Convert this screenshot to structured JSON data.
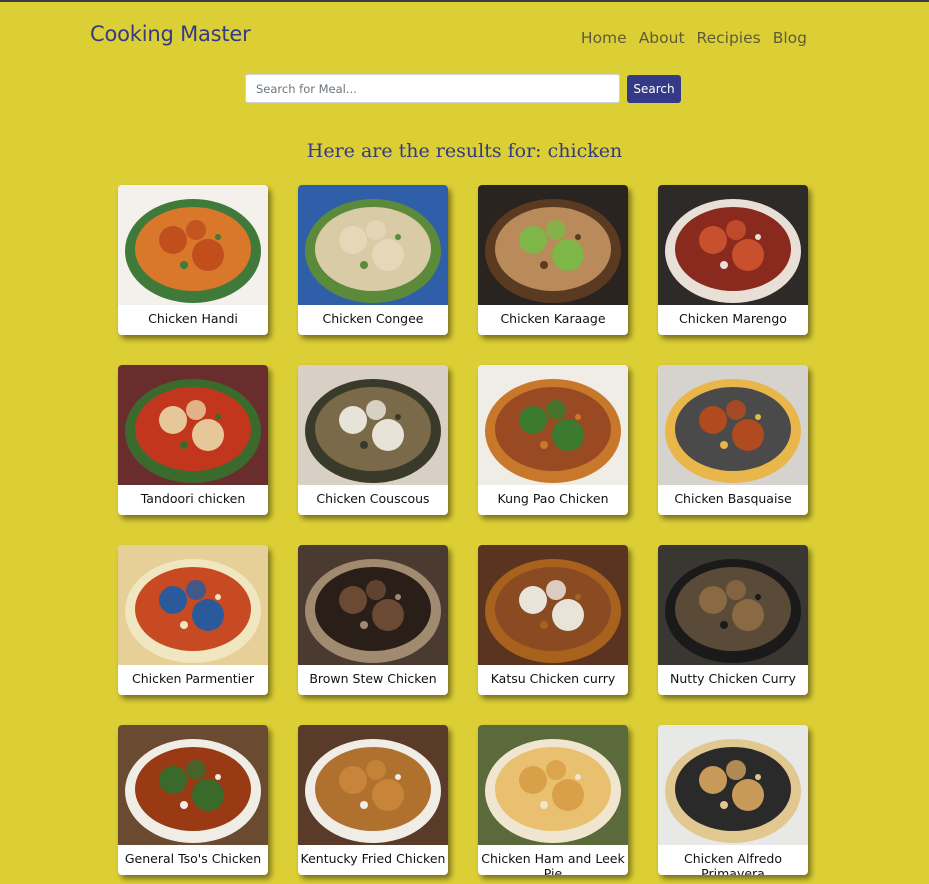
{
  "header": {
    "brand": "Cooking Master",
    "nav": [
      "Home",
      "About",
      "Recipies",
      "Blog"
    ]
  },
  "search": {
    "placeholder": "Search for Meal...",
    "value": "",
    "button_label": "Search"
  },
  "results": {
    "title": "Here are the results for: chicken",
    "meals": [
      {
        "name": "Chicken Handi",
        "colors": [
          "#f4f0ec",
          "#d9772a",
          "#c14f1d",
          "#3f7a3a"
        ]
      },
      {
        "name": "Chicken Congee",
        "colors": [
          "#2f5fa8",
          "#d8cba6",
          "#e6d7b8",
          "#5b8b3a"
        ]
      },
      {
        "name": "Chicken Karaage",
        "colors": [
          "#2a2420",
          "#b98a5a",
          "#7fb648",
          "#5b3a22"
        ]
      },
      {
        "name": "Chicken Marengo",
        "colors": [
          "#2e2a28",
          "#8a2a1f",
          "#c8502c",
          "#e8e0d6"
        ]
      },
      {
        "name": "Tandoori chicken",
        "colors": [
          "#6a2d2d",
          "#c2361d",
          "#e6c79a",
          "#3b6b2c"
        ]
      },
      {
        "name": "Chicken Couscous",
        "colors": [
          "#d8d0c4",
          "#7a6a4a",
          "#e8e3d8",
          "#3a3a2a"
        ]
      },
      {
        "name": "Kung Pao Chicken",
        "colors": [
          "#f0ece6",
          "#9a4a22",
          "#3b7a2f",
          "#c8782a"
        ]
      },
      {
        "name": "Chicken Basquaise",
        "colors": [
          "#d6d2ce",
          "#4a4a4a",
          "#b24a1f",
          "#e8b64a"
        ]
      },
      {
        "name": "Chicken Parmentier",
        "colors": [
          "#e6d098",
          "#c84a22",
          "#2a5a9a",
          "#f0e6c0"
        ]
      },
      {
        "name": "Brown Stew Chicken",
        "colors": [
          "#4a3a30",
          "#2a1f18",
          "#6a4a32",
          "#a08a70"
        ]
      },
      {
        "name": "Katsu Chicken curry",
        "colors": [
          "#5a3420",
          "#8a4a22",
          "#e8e4da",
          "#a8621e"
        ]
      },
      {
        "name": "Nutty Chicken Curry",
        "colors": [
          "#3a3632",
          "#5a4a38",
          "#8a6a42",
          "#1a1a1a"
        ]
      },
      {
        "name": "General Tso's Chicken",
        "colors": [
          "#6a4a30",
          "#9a3a14",
          "#3a6a2a",
          "#f0ede6"
        ]
      },
      {
        "name": "Kentucky Fried Chicken",
        "colors": [
          "#5a3a28",
          "#b0702e",
          "#c8843a",
          "#f0ece6"
        ]
      },
      {
        "name": "Chicken Ham and Leek Pie",
        "colors": [
          "#5a6a3a",
          "#e8c070",
          "#d8a048",
          "#f0e6d0"
        ]
      },
      {
        "name": "Chicken Alfredo Primavera",
        "colors": [
          "#e8e8e6",
          "#2a2a2a",
          "#c89a5a",
          "#e0c890"
        ]
      }
    ]
  },
  "colors": {
    "background": "#dccf35",
    "brand": "#343a86",
    "button": "#343a86"
  }
}
